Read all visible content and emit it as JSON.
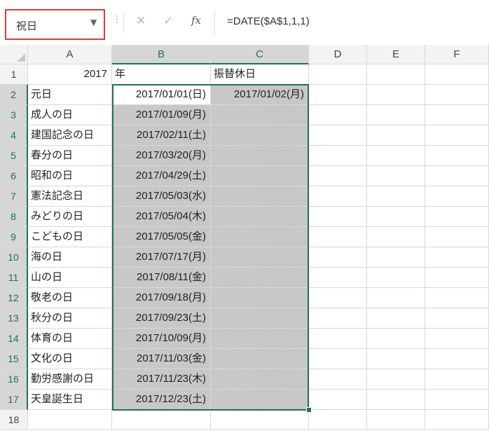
{
  "name_box": {
    "value": "祝日"
  },
  "formula_bar": {
    "fx_label": "fx",
    "formula": "=DATE($A$1,1,1)"
  },
  "columns": [
    "A",
    "B",
    "C",
    "D",
    "E",
    "F"
  ],
  "rows": [
    {
      "num": "1",
      "a": "2017",
      "b": "年",
      "c": "振替休日"
    },
    {
      "num": "2",
      "a": "元日",
      "b": "2017/01/01(日)",
      "c": "2017/01/02(月)"
    },
    {
      "num": "3",
      "a": "成人の日",
      "b": "2017/01/09(月)",
      "c": ""
    },
    {
      "num": "4",
      "a": "建国記念の日",
      "b": "2017/02/11(土)",
      "c": ""
    },
    {
      "num": "5",
      "a": "春分の日",
      "b": "2017/03/20(月)",
      "c": ""
    },
    {
      "num": "6",
      "a": "昭和の日",
      "b": "2017/04/29(土)",
      "c": ""
    },
    {
      "num": "7",
      "a": "憲法記念日",
      "b": "2017/05/03(水)",
      "c": ""
    },
    {
      "num": "8",
      "a": "みどりの日",
      "b": "2017/05/04(木)",
      "c": ""
    },
    {
      "num": "9",
      "a": "こどもの日",
      "b": "2017/05/05(金)",
      "c": ""
    },
    {
      "num": "10",
      "a": "海の日",
      "b": "2017/07/17(月)",
      "c": ""
    },
    {
      "num": "11",
      "a": "山の日",
      "b": "2017/08/11(金)",
      "c": ""
    },
    {
      "num": "12",
      "a": "敬老の日",
      "b": "2017/09/18(月)",
      "c": ""
    },
    {
      "num": "13",
      "a": "秋分の日",
      "b": "2017/09/23(土)",
      "c": ""
    },
    {
      "num": "14",
      "a": "体育の日",
      "b": "2017/10/09(月)",
      "c": ""
    },
    {
      "num": "15",
      "a": "文化の日",
      "b": "2017/11/03(金)",
      "c": ""
    },
    {
      "num": "16",
      "a": "勤労感謝の日",
      "b": "2017/11/23(木)",
      "c": ""
    },
    {
      "num": "17",
      "a": "天皇誕生日",
      "b": "2017/12/23(土)",
      "c": ""
    },
    {
      "num": "18",
      "a": "",
      "b": "",
      "c": ""
    }
  ],
  "colors": {
    "selection": "#217346",
    "name_box_highlight": "#e23a3a"
  }
}
